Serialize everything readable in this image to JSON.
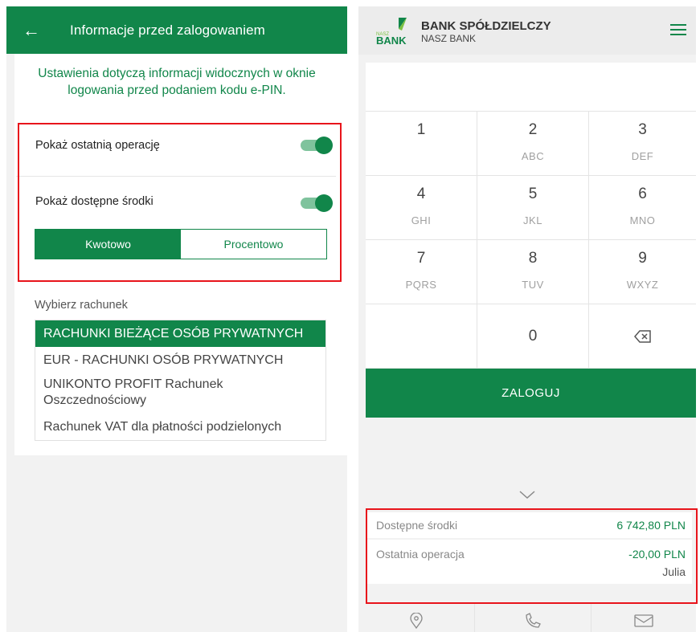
{
  "left_screen": {
    "header_title": "Informacje przed zalogowaniem",
    "intro": "Ustawienia dotyczą informacji widocznych w oknie logowania przed podaniem kodu e-PIN.",
    "toggles": [
      {
        "label": "Pokaż ostatnią operację",
        "on": true
      },
      {
        "label": "Pokaż dostępne środki",
        "on": true
      }
    ],
    "segment": {
      "left": "Kwotowo",
      "right": "Procentowo",
      "selected": "Kwotowo"
    },
    "account_label": "Wybierz rachunek",
    "accounts": [
      "RACHUNKI BIEŻĄCE OSÓB PRYWATNYCH",
      "EUR - RACHUNKI OSÓB PRYWATNYCH",
      "UNIKONTO PROFIT Rachunek Oszczednościowy",
      "Rachunek VAT dla płatności podzielonych"
    ],
    "colors": {
      "brand": "#11864a",
      "highlight": "#e8141b"
    }
  },
  "right_screen": {
    "logo_small": "NASZ",
    "logo_text": "BANK",
    "bank_name": "BANK SPÓŁDZIELCZY",
    "bank_sub": "NASZ BANK",
    "keys": [
      {
        "digit": "1",
        "letters": ""
      },
      {
        "digit": "2",
        "letters": "ABC"
      },
      {
        "digit": "3",
        "letters": "DEF"
      },
      {
        "digit": "4",
        "letters": "GHI"
      },
      {
        "digit": "5",
        "letters": "JKL"
      },
      {
        "digit": "6",
        "letters": "MNO"
      },
      {
        "digit": "7",
        "letters": "PQRS"
      },
      {
        "digit": "8",
        "letters": "TUV"
      },
      {
        "digit": "9",
        "letters": "WXYZ"
      },
      {
        "digit": "",
        "letters": ""
      },
      {
        "digit": "0",
        "letters": ""
      }
    ],
    "login_label": "ZALOGUJ",
    "available_label": "Dostępne środki",
    "available_value": "6 742,80 PLN",
    "last_op_label": "Ostatnia operacja",
    "last_op_value": "-20,00 PLN",
    "last_op_name": "Julia",
    "icons": [
      "chevron-down-icon",
      "location-pin-icon",
      "phone-icon",
      "mail-icon",
      "backspace-icon",
      "hamburger-menu-icon"
    ]
  }
}
